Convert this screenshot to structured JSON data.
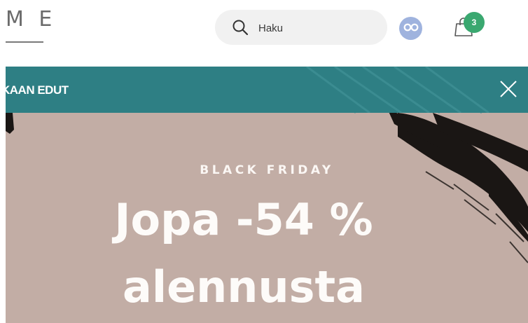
{
  "header": {
    "logo_text": "M E",
    "search": {
      "placeholder": "Haku",
      "icon": "search-icon"
    },
    "profile_icon": "loyalty-infinity-icon",
    "cart": {
      "icon": "shopping-bag-icon",
      "count": "3"
    }
  },
  "promo_bar": {
    "text": "KAAN EDUT",
    "close_icon": "close-icon"
  },
  "hero": {
    "eyebrow": "BLACK FRIDAY",
    "headline_line1": "Jopa -54 %",
    "headline_line2": "alennusta"
  },
  "colors": {
    "teal": "#2e7f84",
    "hero_bg": "#c2ada5",
    "badge": "#3aa870",
    "avatar": "#9fb3de"
  }
}
